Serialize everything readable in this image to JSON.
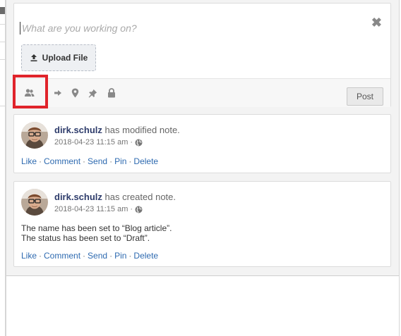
{
  "composer": {
    "placeholder": "What are you working on?",
    "close_glyph": "✖",
    "upload_label": "Upload File",
    "post_label": "Post",
    "tools": [
      {
        "icon": "users-icon"
      },
      {
        "icon": "arrow-right-icon"
      },
      {
        "icon": "map-marker-icon"
      },
      {
        "icon": "pushpin-icon"
      },
      {
        "icon": "lock-icon"
      }
    ]
  },
  "notes": [
    {
      "user": "dirk.schulz",
      "action": "has modified note.",
      "timestamp": "2018-04-23 11:15 am",
      "separator": "·",
      "body_lines": [],
      "actions": [
        "Like",
        "Comment",
        "Send",
        "Pin",
        "Delete"
      ]
    },
    {
      "user": "dirk.schulz",
      "action": "has created note.",
      "timestamp": "2018-04-23 11:15 am",
      "separator": "·",
      "body_lines": [
        "The name has been set to “Blog article”.",
        "The status has been set to “Draft”."
      ],
      "actions": [
        "Like",
        "Comment",
        "Send",
        "Pin",
        "Delete"
      ]
    }
  ],
  "colors": {
    "highlight": "#e0242b",
    "username": "#2e3c6b",
    "link": "#2e6ab0"
  }
}
